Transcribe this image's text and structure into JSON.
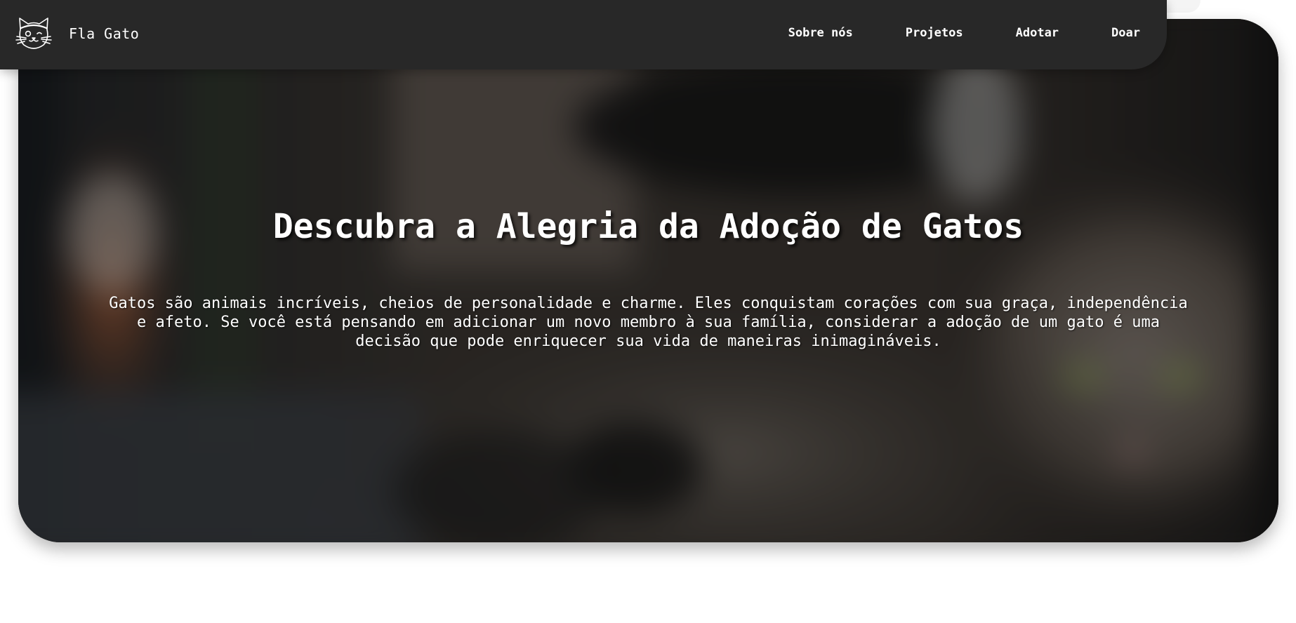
{
  "header": {
    "brand_name": "Fla Gato",
    "logo_icon": "cat-face-icon",
    "nav": [
      {
        "label": "Sobre nós"
      },
      {
        "label": "Projetos"
      },
      {
        "label": "Adotar"
      },
      {
        "label": "Doar"
      }
    ]
  },
  "hero": {
    "title": "Descubra a Alegria da Adoção de Gatos",
    "text": "Gatos são animais incríveis, cheios de personalidade e charme. Eles conquistam corações com sua graça, independência e afeto. Se você está pensando em adicionar um novo membro à sua família, considerar a adoção de um gato é uma decisão que pode enriquecer sua vida de maneiras inimagináveis.",
    "background": "blurred-cat-photo"
  },
  "colors": {
    "navbar": "#282828",
    "text": "#ffffff",
    "page_background": "#ffffff"
  }
}
